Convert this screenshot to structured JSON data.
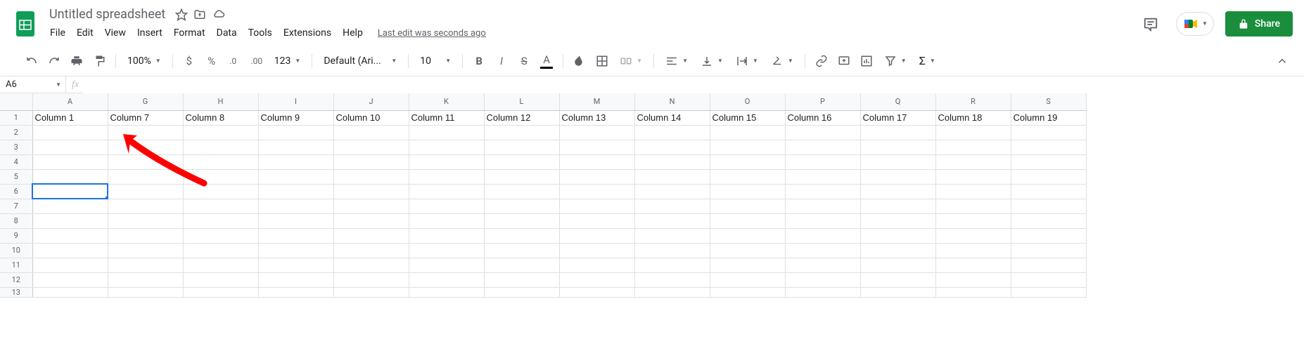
{
  "header": {
    "title": "Untitled spreadsheet",
    "menus": [
      "File",
      "Edit",
      "View",
      "Insert",
      "Format",
      "Data",
      "Tools",
      "Extensions",
      "Help"
    ],
    "last_edit": "Last edit was seconds ago",
    "share_label": "Share"
  },
  "toolbar": {
    "zoom": "100%",
    "font": "Default (Ari...",
    "font_size": "10",
    "more_formats": "123"
  },
  "name_box": "A6",
  "formula": "",
  "columns": [
    "A",
    "G",
    "H",
    "I",
    "J",
    "K",
    "L",
    "M",
    "N",
    "O",
    "P",
    "Q",
    "R",
    "S"
  ],
  "rows": [
    1,
    2,
    3,
    4,
    5,
    6,
    7,
    8,
    9,
    10,
    11,
    12,
    13
  ],
  "row1": [
    "Column 1",
    "Column 7",
    "Column 8",
    "Column 9",
    "Column 10",
    "Column 11",
    "Column 12",
    "Column 13",
    "Column 14",
    "Column 15",
    "Column 16",
    "Column 17",
    "Column 18",
    "Column 19"
  ],
  "selected_cell": {
    "row": 6,
    "col": "A"
  }
}
